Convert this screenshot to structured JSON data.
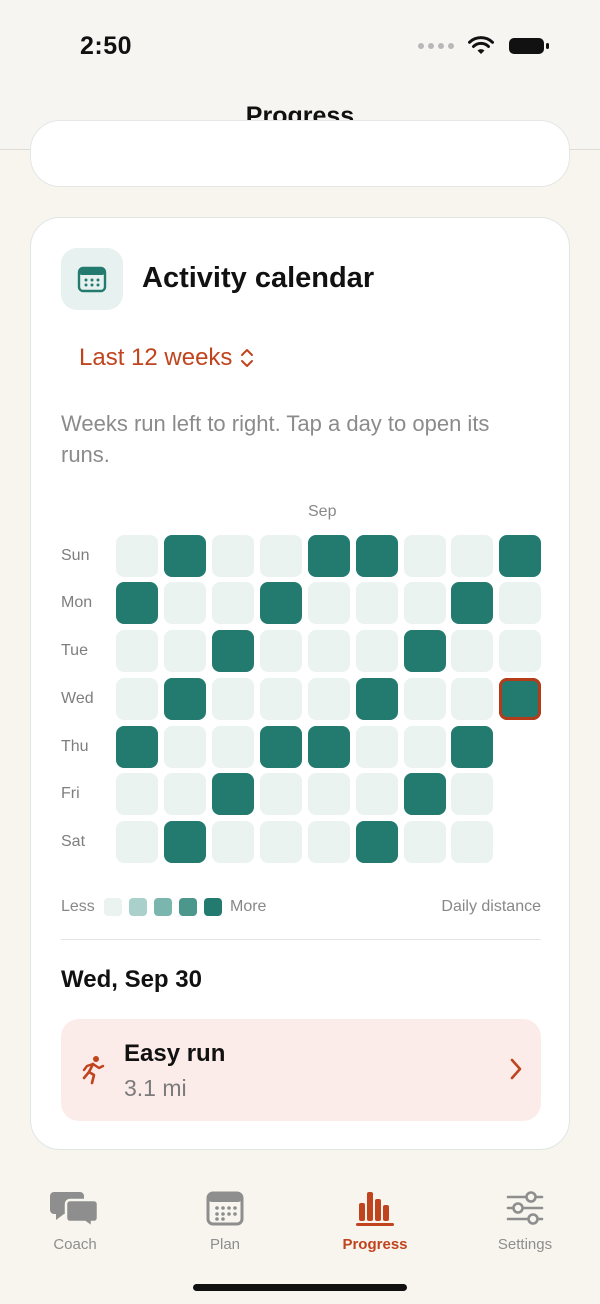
{
  "status_bar": {
    "time": "2:50"
  },
  "nav": {
    "title": "Progress"
  },
  "card": {
    "title": "Activity calendar",
    "range_label": "Last 12 weeks",
    "hint": "Weeks run left to right. Tap a day to open its runs.",
    "month_label": "Sep",
    "day_labels": [
      "Sun",
      "Mon",
      "Tue",
      "Wed",
      "Thu",
      "Fri",
      "Sat"
    ],
    "grid": [
      [
        0,
        1,
        0,
        0,
        1,
        1,
        0,
        0,
        1
      ],
      [
        1,
        0,
        0,
        1,
        0,
        0,
        0,
        1,
        0
      ],
      [
        0,
        0,
        1,
        0,
        0,
        0,
        1,
        0,
        0
      ],
      [
        0,
        1,
        0,
        0,
        0,
        1,
        0,
        0,
        1
      ],
      [
        1,
        0,
        0,
        1,
        1,
        0,
        0,
        1,
        null
      ],
      [
        0,
        0,
        1,
        0,
        0,
        0,
        1,
        0,
        null
      ],
      [
        0,
        1,
        0,
        0,
        0,
        1,
        0,
        0,
        null
      ]
    ],
    "selected_day": {
      "row": 3,
      "week": 8
    },
    "legend": {
      "less": "Less",
      "more": "More",
      "caption": "Daily distance",
      "colors": [
        "#ebf3f1",
        "#a9d0ca",
        "#7ab6ad",
        "#4c978b",
        "#237a6e"
      ]
    },
    "selected_date": "Wed, Sep 30",
    "run": {
      "title": "Easy run",
      "distance": "3.1 mi",
      "icon": "runner-icon"
    }
  },
  "tabs": [
    {
      "label": "Coach",
      "icon": "chat-bubbles-icon",
      "active": false
    },
    {
      "label": "Plan",
      "icon": "calendar-icon",
      "active": false
    },
    {
      "label": "Progress",
      "icon": "bar-chart-icon",
      "active": true
    },
    {
      "label": "Settings",
      "icon": "sliders-icon",
      "active": false
    }
  ],
  "colors": {
    "accent": "#c0441e",
    "activity": "#237a6e",
    "empty": "#ebf3f1"
  }
}
